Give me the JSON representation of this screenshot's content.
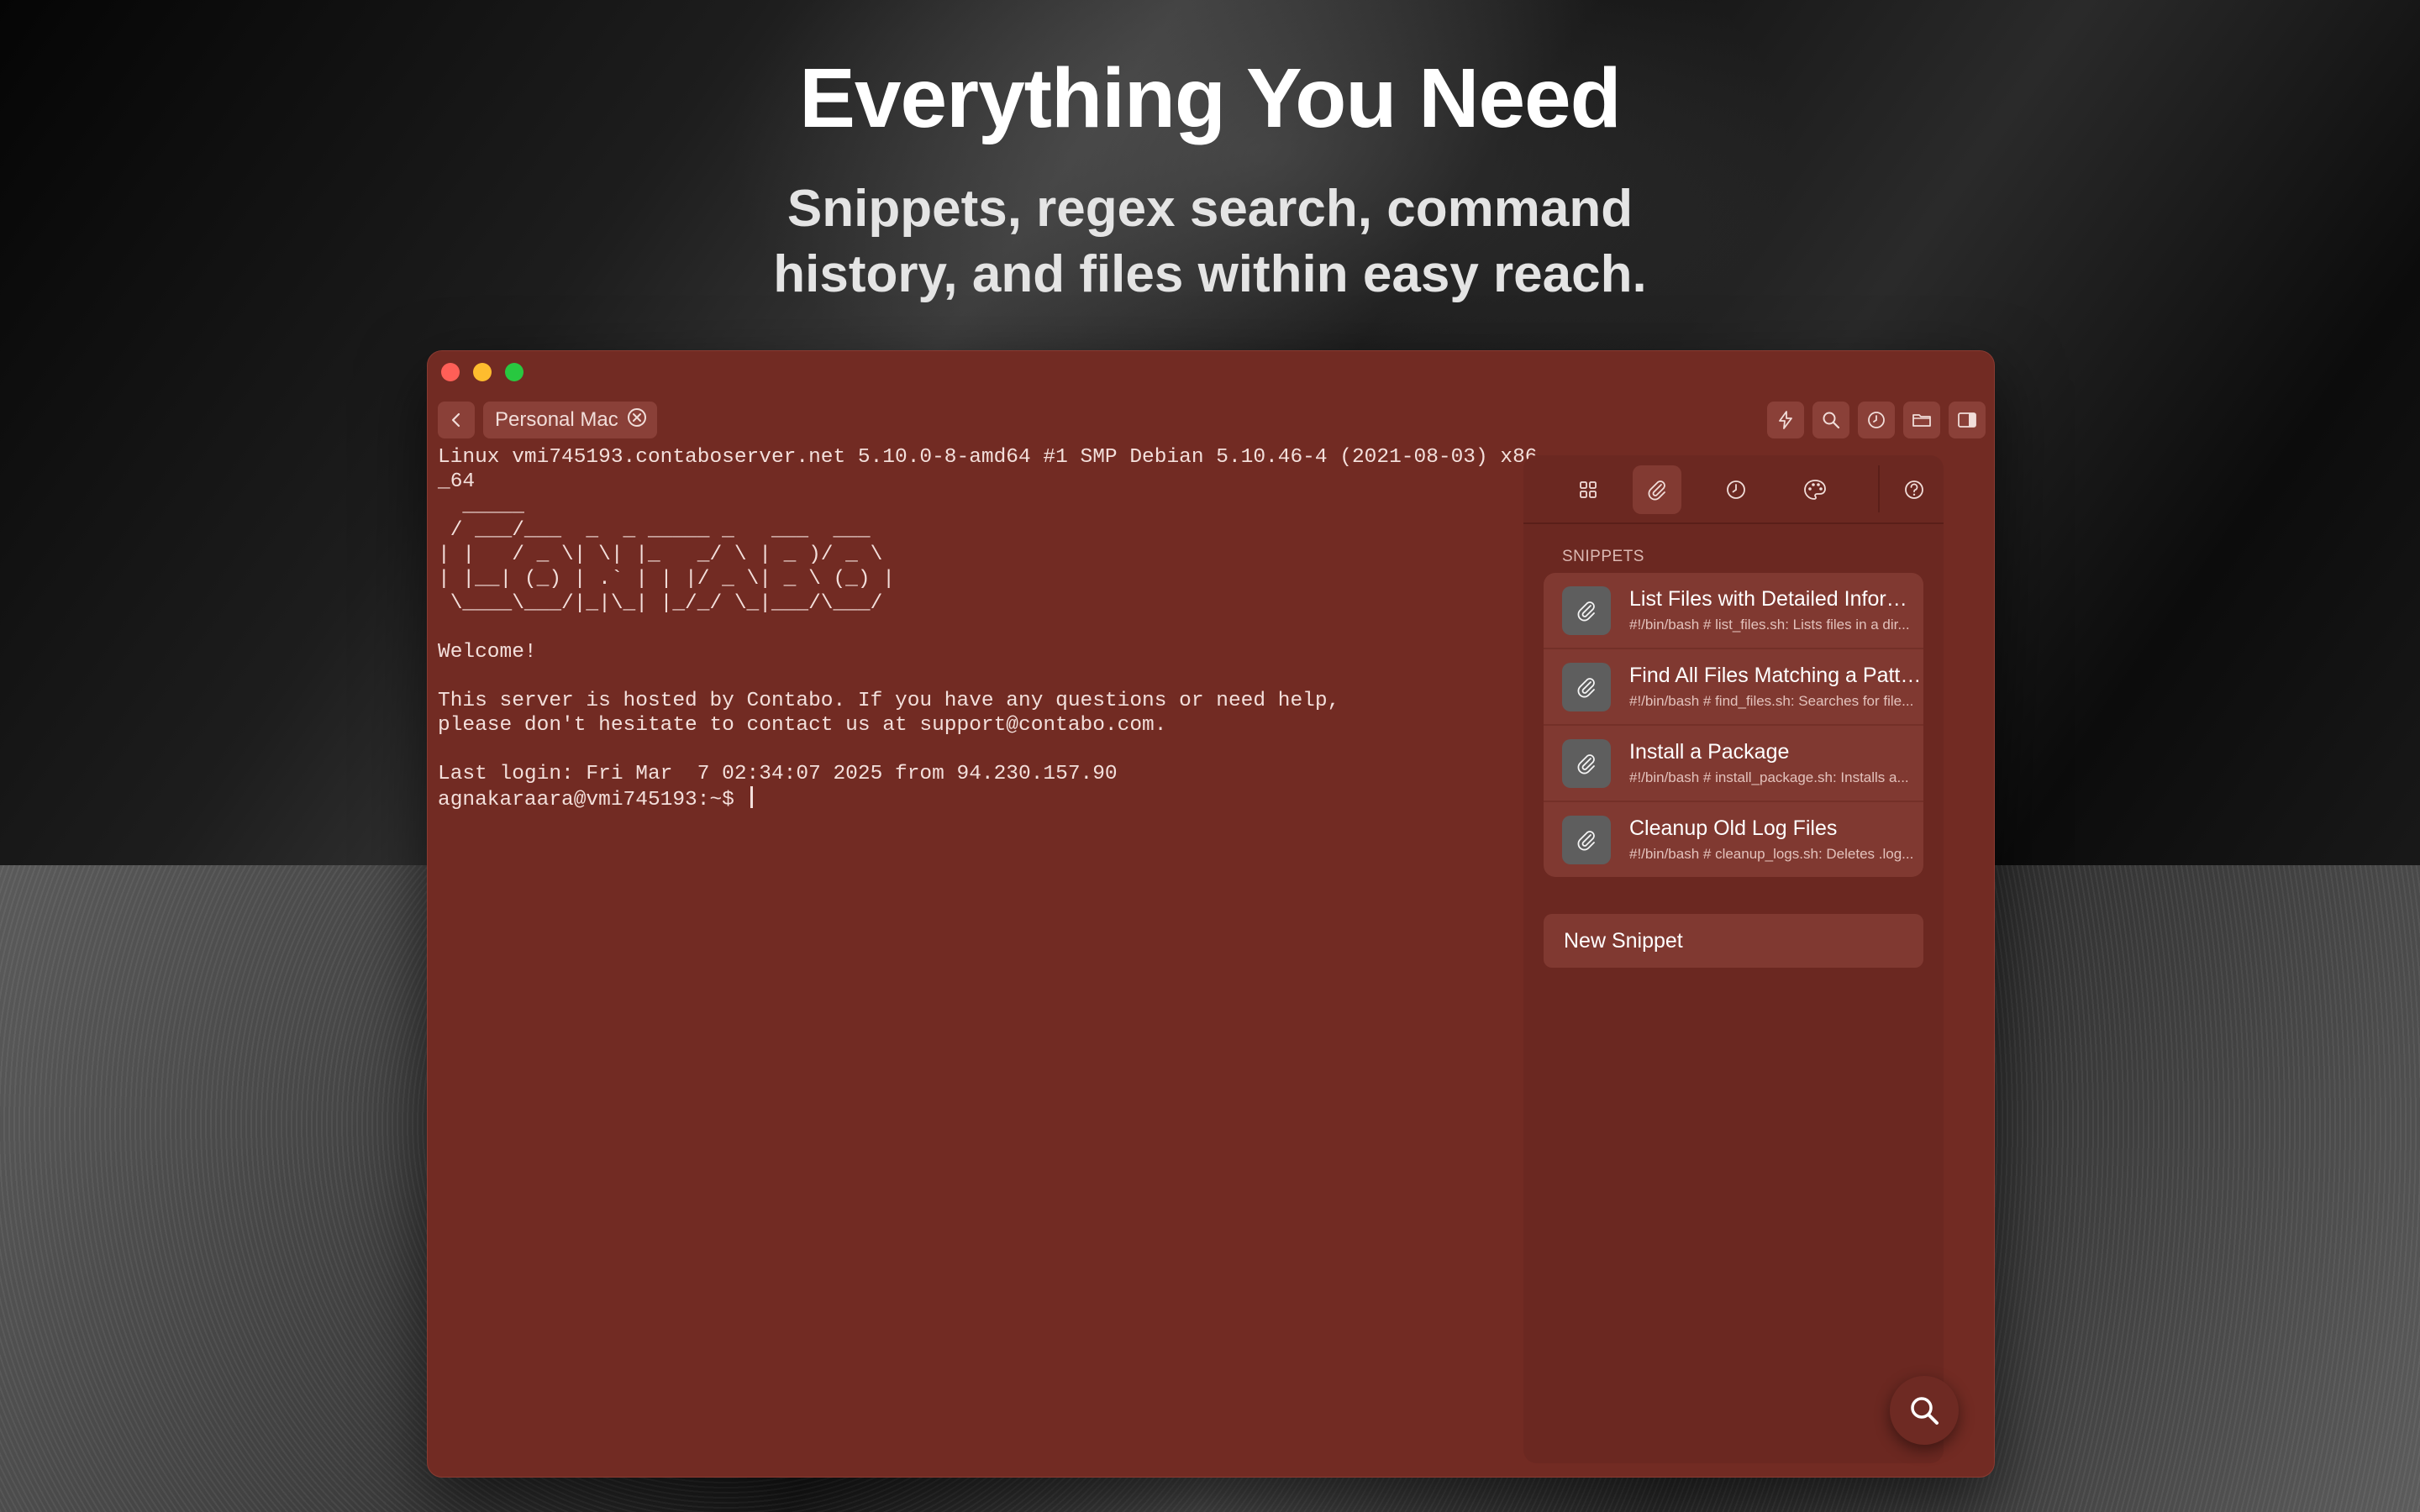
{
  "hero": {
    "title": "Everything You Need",
    "subtitle_line1": "Snippets, regex search, command",
    "subtitle_line2": "history, and files within easy reach."
  },
  "window": {
    "tab_label": "Personal Mac"
  },
  "toolbar": {
    "icons": [
      "lightning-icon",
      "search-icon",
      "history-icon",
      "folder-icon",
      "sidebar-icon"
    ]
  },
  "terminal": {
    "lines": [
      "Linux vmi745193.contaboserver.net 5.10.0-8-amd64 #1 SMP Debian 5.10.46-4 (2021-08-03) x86",
      "_64",
      "  _____",
      " / ___/___  _  _ _____ _   ___  ___",
      "| |   / _ \\| \\| |_   _/ \\ | _ )/ _ \\",
      "| |__| (_) | .` | | |/ _ \\| _ \\ (_) |",
      " \\____\\___/|_|\\_| |_/_/ \\_|___/\\___/",
      "",
      "Welcome!",
      "",
      "This server is hosted by Contabo. If you have any questions or need help,",
      "please don't hesitate to contact us at support@contabo.com.",
      "",
      "Last login: Fri Mar  7 02:34:07 2025 from 94.230.157.90"
    ],
    "prompt": "agnakaraara@vmi745193:~$ "
  },
  "panel": {
    "section_label": "SNIPPETS",
    "snippets": [
      {
        "title": "List Files with Detailed Information",
        "preview": "#!/bin/bash # list_files.sh: Lists files in a dir..."
      },
      {
        "title": "Find All Files Matching a Pattern",
        "preview": "#!/bin/bash # find_files.sh: Searches for file..."
      },
      {
        "title": "Install a Package",
        "preview": "#!/bin/bash # install_package.sh: Installs a..."
      },
      {
        "title": "Cleanup Old Log Files",
        "preview": "#!/bin/bash # cleanup_logs.sh: Deletes .log..."
      }
    ],
    "new_snippet_label": "New Snippet"
  },
  "colors": {
    "window_bg": "#722b23",
    "panel_bg": "#6b2821",
    "row_bg": "#803931",
    "terminal_text": "#f3dfdb"
  }
}
